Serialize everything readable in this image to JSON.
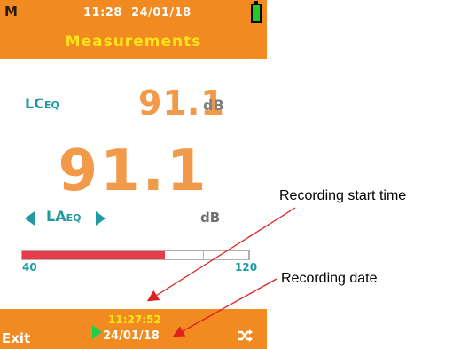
{
  "status": {
    "mode": "M",
    "time": "11:28",
    "date": "24/01/18",
    "battery": "full"
  },
  "header": {
    "title": "Measurements"
  },
  "lceq": {
    "label_main": "LC",
    "label_sub": "EQ",
    "value": "91.1",
    "unit": "dB"
  },
  "main_reading": {
    "value": "91.1"
  },
  "laeq": {
    "label_main": "LA",
    "label_sub": "EQ",
    "unit": "dB"
  },
  "level_bar": {
    "min_label": "40",
    "max_label": "120",
    "fill_fraction": 0.63,
    "fill_color": "#e83c4c",
    "segments": 5
  },
  "footer": {
    "exit_label": "Exit",
    "recording_time": "11:27:52",
    "recording_date": "24/01/18",
    "shuffle_icon": "shuffle-icon"
  },
  "annotations": {
    "start_time": "Recording start time",
    "date": "Recording date"
  },
  "colors": {
    "brand_orange": "#f18a21",
    "title_yellow": "#ffe41a",
    "value_orange": "#f39a4a",
    "teal": "#1e9aa0",
    "play_green": "#19d04a",
    "arrow_red": "#e02020"
  }
}
